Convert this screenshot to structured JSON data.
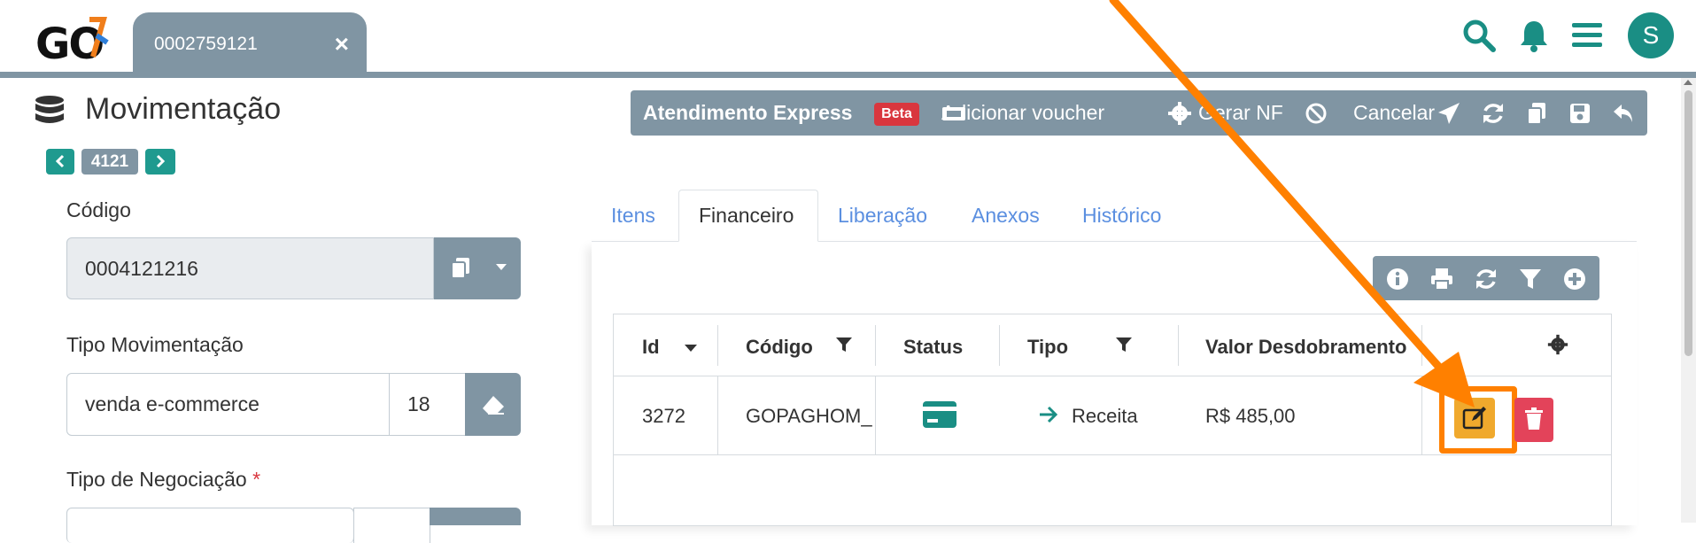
{
  "app": {
    "logo_text": "GO"
  },
  "tab": {
    "label": "0002759121",
    "close": "×"
  },
  "user": {
    "avatar_initial": "S"
  },
  "page": {
    "title": "Movimentação",
    "record_number": "4121"
  },
  "form": {
    "codigo": {
      "label": "Código",
      "value": "0004121216"
    },
    "tipo_movimentacao": {
      "label": "Tipo Movimentação",
      "value": "venda e-commerce",
      "code": "18"
    },
    "tipo_negociacao": {
      "label": "Tipo de Negociação",
      "required_mark": "*"
    }
  },
  "toolbar": {
    "title": "Atendimento Express",
    "badge": "Beta",
    "voucher": "Adicionar voucher",
    "gerar_nf": "Gerar NF",
    "cancelar": "Cancelar"
  },
  "content_tabs": [
    {
      "label": "Itens"
    },
    {
      "label": "Financeiro"
    },
    {
      "label": "Liberação"
    },
    {
      "label": "Anexos"
    },
    {
      "label": "Histórico"
    }
  ],
  "grid": {
    "columns": [
      "Id",
      "Código",
      "Status",
      "Tipo",
      "Valor Desdobramento"
    ],
    "rows": [
      {
        "id": "3272",
        "codigo": "GOPAGHOM_",
        "status": "card-icon",
        "tipo": "Receita",
        "valor": "R$ 485,00"
      }
    ]
  },
  "colors": {
    "accent": "#1a8e84",
    "toolbar": "#8095a3",
    "danger": "#e3435a",
    "warning": "#f0a92d",
    "annotation": "#ff8000"
  }
}
